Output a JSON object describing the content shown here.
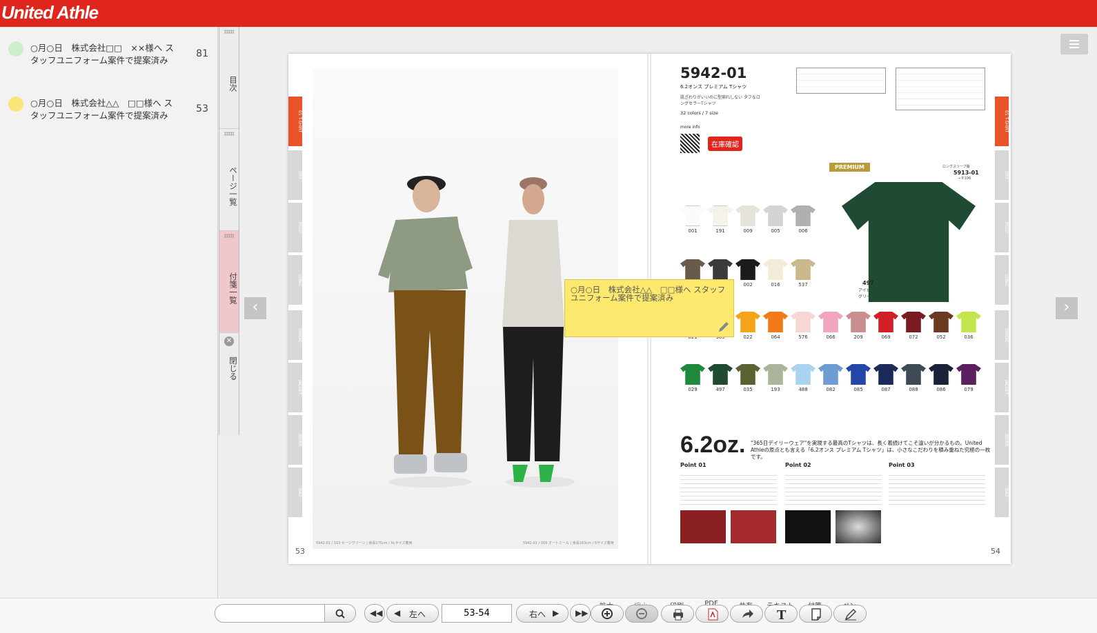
{
  "header": {
    "logo": "United Athle"
  },
  "sidebar": {
    "notes": [
      {
        "text": "○月○日　株式会社□□　××様へ スタッフユニフォーム案件で提案済み",
        "page": "81",
        "color": "#cdeeca"
      },
      {
        "text": "○月○日　株式会社△△　□□様へ スタッフユニフォーム案件で提案済み",
        "page": "53",
        "color": "#fbe577"
      }
    ]
  },
  "tabs": [
    {
      "label": "目次"
    },
    {
      "label": "ページ一覧"
    },
    {
      "label": "付箋一覧"
    },
    {
      "label": "閉じる"
    }
  ],
  "catalog": {
    "left_page_number": "53",
    "right_page_number": "54",
    "left_caption": "5942-01 / 193 セージグリーン | 身長175cm / XLサイズ着用",
    "right_caption": "5942-01 / 009 オートミール | 身長163cm / Sサイズ着用",
    "product_code": "5942-01",
    "product_name": "6.2オンス プレミアム Tシャツ",
    "product_desc": "肌ざわりがいいのに型崩れしない タフなロングセラーTシャツ",
    "colors_size": "32 colors / 7 size",
    "more_info": "more info",
    "stock_button": "在庫確認",
    "premium_badge": "PREMIUM",
    "featured": {
      "code": "497",
      "name": "アイビー グリーン"
    },
    "related": {
      "label": "ロングスリーブ版",
      "code": "5913-01",
      "page": "→ P.106"
    },
    "headline": "6.2oz.",
    "tagline": "\"365日デイリーウェア\"を実現する最高のTシャツは、長く着続けてこそ違いが分かるもの。United Athleの原点とも言える「6.2オンス プレミアム Tシャツ」は、小さなこだわりを積み重ねた究極の一枚です。",
    "points": [
      "Point 01",
      "Point 02",
      "Point 03"
    ],
    "swatches": [
      {
        "code": "001",
        "color": "#fafafa"
      },
      {
        "code": "191",
        "color": "#f4f2ea"
      },
      {
        "code": "009",
        "color": "#e6e3db"
      },
      {
        "code": "005",
        "color": "#d3d4d6"
      },
      {
        "code": "006",
        "color": "#b0b0b2"
      },
      {
        "code": "",
        "color": "#6a5a4a"
      },
      {
        "code": "",
        "color": "#3a3a3a"
      },
      {
        "code": "002",
        "color": "#1b1b1b"
      },
      {
        "code": "016",
        "color": "#f4ecd8"
      },
      {
        "code": "537",
        "color": "#cbb98e"
      },
      {
        "code": "021",
        "color": "#f6da2a"
      },
      {
        "code": "369",
        "color": "#f2c21a"
      },
      {
        "code": "022",
        "color": "#f5a318"
      },
      {
        "code": "064",
        "color": "#f47a18"
      },
      {
        "code": "576",
        "color": "#f7d6d4"
      },
      {
        "code": "066",
        "color": "#f2a6bd"
      },
      {
        "code": "209",
        "color": "#c98e8e"
      },
      {
        "code": "069",
        "color": "#d11f25"
      },
      {
        "code": "072",
        "color": "#7a1c22"
      },
      {
        "code": "052",
        "color": "#6c3a22"
      },
      {
        "code": "036",
        "color": "#c4e64c"
      },
      {
        "code": "029",
        "color": "#1f8a3c"
      },
      {
        "code": "497",
        "color": "#214a33"
      },
      {
        "code": "035",
        "color": "#5a6232"
      },
      {
        "code": "193",
        "color": "#aab59b"
      },
      {
        "code": "488",
        "color": "#aad3f0"
      },
      {
        "code": "082",
        "color": "#6e9bd2"
      },
      {
        "code": "085",
        "color": "#2446a8"
      },
      {
        "code": "087",
        "color": "#1c2a5a"
      },
      {
        "code": "088",
        "color": "#3e4a55"
      },
      {
        "code": "086",
        "color": "#1a2138"
      },
      {
        "code": "079",
        "color": "#5a2060"
      }
    ]
  },
  "sticky_note": {
    "text": "○月○日　株式会社△△　□□様へ スタッフユニフォーム案件で提案済み"
  },
  "toolbar": {
    "search_placeholder": "",
    "prev_label": "左へ",
    "next_label": "右へ",
    "page_value": "53-54",
    "labels": {
      "zoom_in": "拡大",
      "zoom_out": "縮小",
      "print": "印刷",
      "pdf": "PDF",
      "share": "共有",
      "text": "テキスト",
      "sticky": "付箋",
      "pen": "ペン"
    }
  }
}
